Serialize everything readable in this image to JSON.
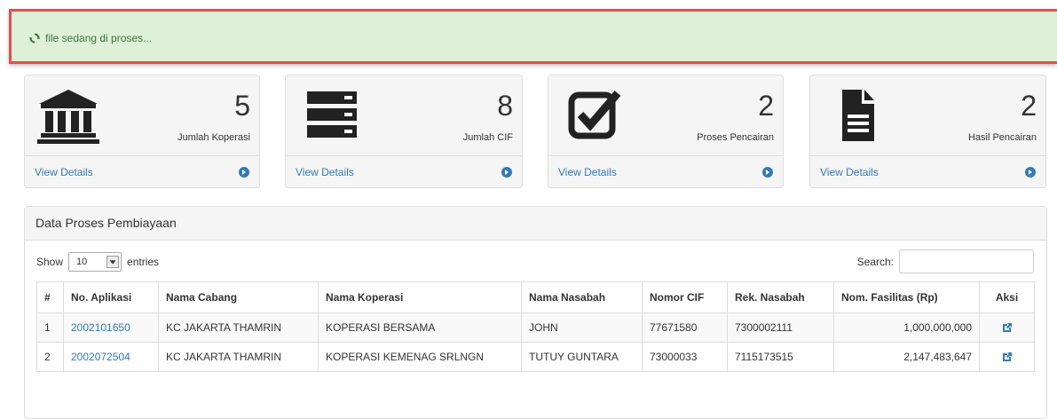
{
  "notice": {
    "text": "file sedang di proses..."
  },
  "stats": [
    {
      "value": "5",
      "label": "Jumlah Koperasi",
      "icon": "bank-icon",
      "link": "View Details"
    },
    {
      "value": "8",
      "label": "Jumlah CIF",
      "icon": "server-icon",
      "link": "View Details"
    },
    {
      "value": "2",
      "label": "Proses Pencairan",
      "icon": "check-square-icon",
      "link": "View Details"
    },
    {
      "value": "2",
      "label": "Hasil Pencairan",
      "icon": "file-icon",
      "link": "View Details"
    }
  ],
  "data_panel": {
    "title": "Data Proses Pembiayaan",
    "show_label": "Show",
    "entries_value": "10",
    "entries_label": "entries",
    "search_label": "Search:",
    "search_value": "",
    "columns": [
      "#",
      "No. Aplikasi",
      "Nama Cabang",
      "Nama Koperasi",
      "Nama Nasabah",
      "Nomor CIF",
      "Rek. Nasabah",
      "Nom. Fasilitas (Rp)",
      "Aksi"
    ],
    "rows": [
      {
        "no": "1",
        "aplikasi": "2002101650",
        "cabang": "KC JAKARTA THAMRIN",
        "koperasi": "KOPERASI BERSAMA",
        "nasabah": "JOHN",
        "cif": "77671580",
        "rekening": "7300002111",
        "fasilitas": "1,000,000,000"
      },
      {
        "no": "2",
        "aplikasi": "2002072504",
        "cabang": "KC JAKARTA THAMRIN",
        "koperasi": "KOPERASI KEMENAG SRLNGN",
        "nasabah": "TUTUY GUNTARA",
        "cif": "73000033",
        "rekening": "7115173515",
        "fasilitas": "2,147,483,647"
      }
    ]
  },
  "colors": {
    "notice_bg": "#dff0d8",
    "notice_border": "#e05050",
    "notice_text": "#3c763d",
    "link": "#337ab7",
    "icon_dark": "#222222"
  }
}
